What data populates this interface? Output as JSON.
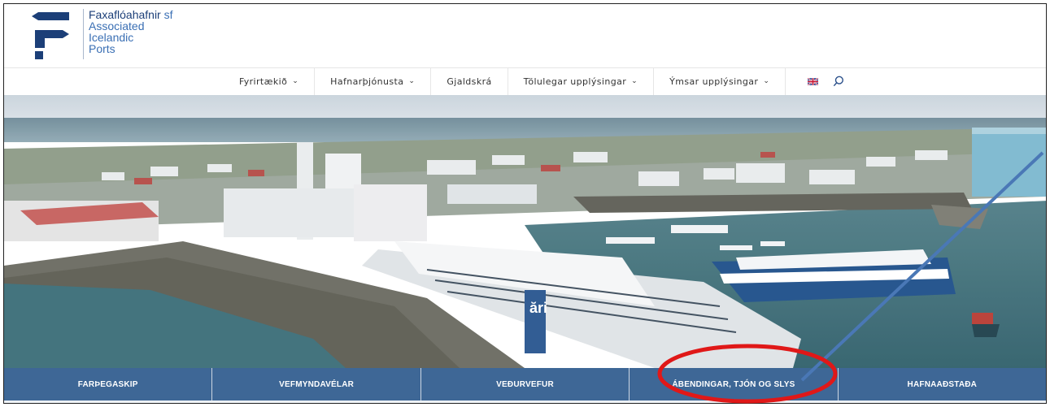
{
  "logo": {
    "brand": "Faxaflóahafnir",
    "suffix": "sf",
    "line2": "Associated",
    "line3": "Icelandic",
    "line4": "Ports"
  },
  "nav": {
    "items": [
      {
        "label": "Fyrirtækið",
        "dropdown": true
      },
      {
        "label": "Hafnarþjónusta",
        "dropdown": true
      },
      {
        "label": "Gjaldskrá",
        "dropdown": false
      },
      {
        "label": "Tölulegar upplýsingar",
        "dropdown": true
      },
      {
        "label": "Ýmsar upplýsingar",
        "dropdown": true
      }
    ],
    "chevron": "⌄",
    "language_icon": "uk-flag-icon",
    "search_icon": "search-icon"
  },
  "hero": {
    "ship_sign": "ări"
  },
  "tiles": [
    {
      "label": "FARÞEGASKIP"
    },
    {
      "label": "VEFMYNDAVÉLAR"
    },
    {
      "label": "VEÐURVEFUR"
    },
    {
      "label": "ÁBENDINGAR, TJÓN OG SLYS"
    },
    {
      "label": "HAFNAAÐSTAÐA"
    }
  ],
  "annotation": {
    "circle_color": "#e01818",
    "arrow_color": "#4a78b6",
    "highlighted_tile": "ÁBENDINGAR, TJÓN OG SLYS"
  },
  "colors": {
    "tile_bg": "#3e6796",
    "logo_dark": "#1c3f78",
    "logo_light": "#3a6fb4"
  }
}
